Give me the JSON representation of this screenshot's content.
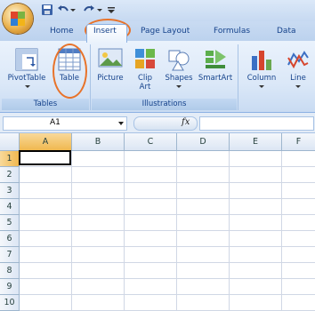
{
  "quick_access": {
    "icons": [
      "save-icon",
      "undo-icon",
      "redo-icon",
      "customize-dropdown-icon"
    ]
  },
  "tabs": [
    {
      "label": "Home"
    },
    {
      "label": "Insert",
      "active": true
    },
    {
      "label": "Page Layout"
    },
    {
      "label": "Formulas"
    },
    {
      "label": "Data"
    }
  ],
  "ribbon": {
    "groups": [
      {
        "label": "Tables",
        "buttons": [
          {
            "label": "PivotTable",
            "icon": "pivottable-icon",
            "dropdown": true
          },
          {
            "label": "Table",
            "icon": "table-icon"
          }
        ]
      },
      {
        "label": "Illustrations",
        "buttons": [
          {
            "label": "Picture",
            "icon": "picture-icon"
          },
          {
            "label": "Clip Art",
            "icon": "clip-art-icon"
          },
          {
            "label": "Shapes",
            "icon": "shapes-icon",
            "dropdown": true
          },
          {
            "label": "SmartArt",
            "icon": "smartart-icon"
          }
        ]
      },
      {
        "label": "",
        "buttons": [
          {
            "label": "Column",
            "icon": "column-chart-icon",
            "dropdown": true
          },
          {
            "label": "Line",
            "icon": "line-chart-icon",
            "dropdown": true
          }
        ]
      }
    ]
  },
  "formula_bar": {
    "name_box": "A1",
    "fx_label": "fx",
    "value": ""
  },
  "sheet": {
    "columns": [
      "A",
      "B",
      "C",
      "D",
      "E",
      "F"
    ],
    "rows": [
      "1",
      "2",
      "3",
      "4",
      "5",
      "6",
      "7",
      "8",
      "9",
      "10"
    ],
    "active_cell": "A1"
  },
  "annotations": {
    "color": "#e8732a",
    "highlighted": [
      "Insert tab",
      "Table button"
    ]
  },
  "colors": {
    "ribbon_text": "#15428b",
    "selected_header": "#f0b84f",
    "gridline": "#d0d7e5"
  }
}
